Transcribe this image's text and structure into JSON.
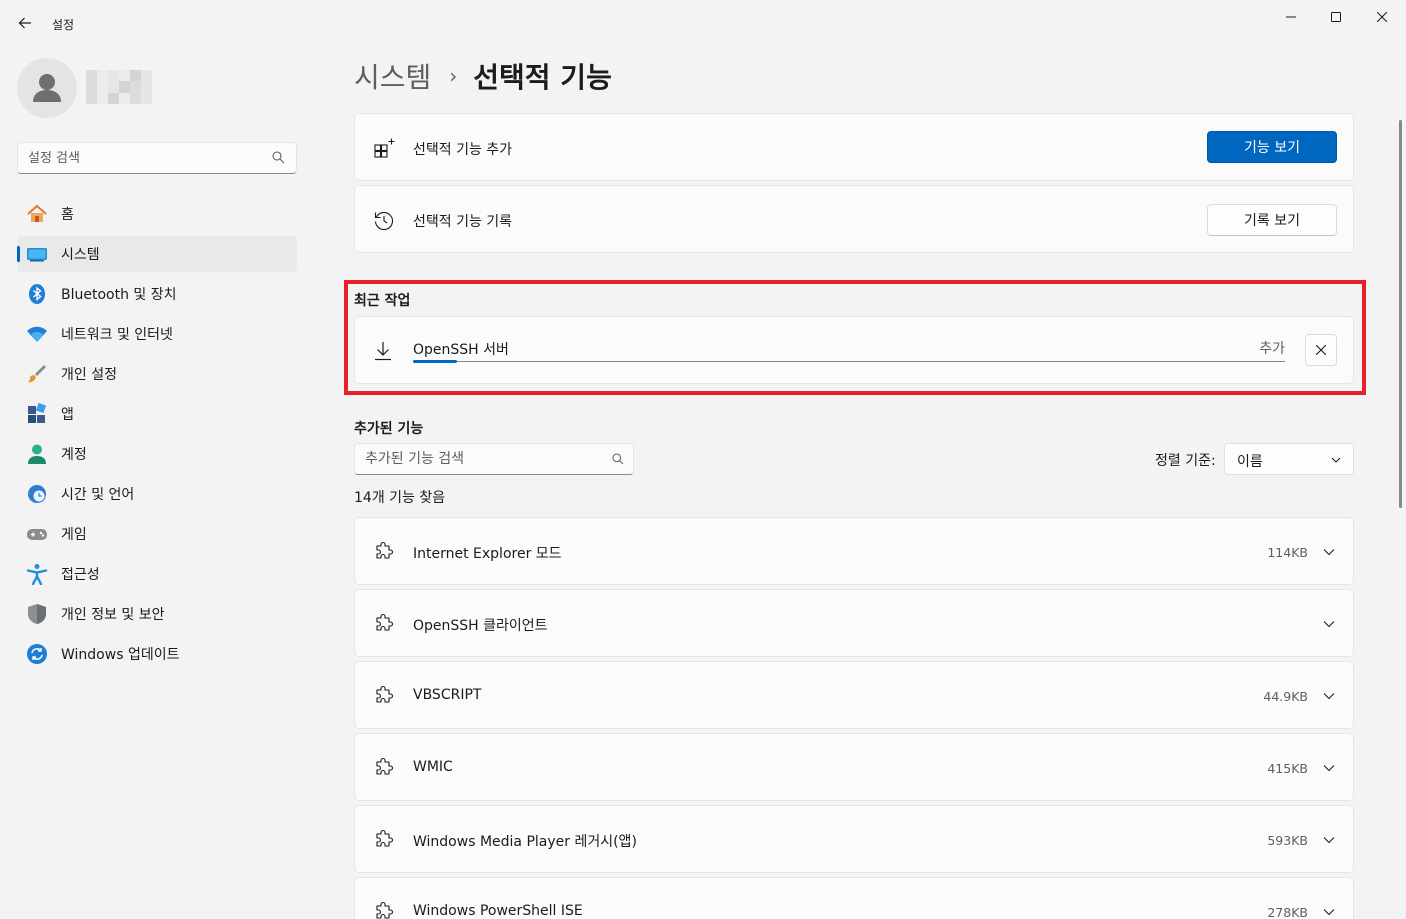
{
  "window": {
    "title": "설정",
    "back_icon": "arrow-left-icon",
    "controls": [
      "minimize",
      "maximize",
      "close"
    ]
  },
  "sidebar": {
    "search_placeholder": "설정 검색",
    "items": [
      {
        "label": "홈",
        "icon": "home-icon",
        "active": false
      },
      {
        "label": "시스템",
        "icon": "system-monitor-icon",
        "active": true
      },
      {
        "label": "Bluetooth 및 장치",
        "icon": "bluetooth-icon",
        "active": false
      },
      {
        "label": "네트워크 및 인터넷",
        "icon": "wifi-icon",
        "active": false
      },
      {
        "label": "개인 설정",
        "icon": "paintbrush-icon",
        "active": false
      },
      {
        "label": "앱",
        "icon": "apps-icon",
        "active": false
      },
      {
        "label": "계정",
        "icon": "account-icon",
        "active": false
      },
      {
        "label": "시간 및 언어",
        "icon": "globe-clock-icon",
        "active": false
      },
      {
        "label": "게임",
        "icon": "gamepad-icon",
        "active": false
      },
      {
        "label": "접근성",
        "icon": "accessibility-icon",
        "active": false
      },
      {
        "label": "개인 정보 및 보안",
        "icon": "shield-icon",
        "active": false
      },
      {
        "label": "Windows 업데이트",
        "icon": "update-icon",
        "active": false
      }
    ]
  },
  "breadcrumb": {
    "parent": "시스템",
    "separator": "›",
    "current": "선택적 기능"
  },
  "actions": {
    "add": {
      "label": "선택적 기능 추가",
      "button": "기능 보기",
      "icon": "add-grid-icon"
    },
    "history": {
      "label": "선택적 기능 기록",
      "button": "기록 보기",
      "icon": "history-icon"
    }
  },
  "recent": {
    "title": "최근 작업",
    "item": {
      "name": "OpenSSH 서버",
      "status": "추가",
      "progress_fraction": 0.05,
      "icon": "download-icon"
    }
  },
  "installed": {
    "title": "추가된 기능",
    "search_placeholder": "추가된 기능 검색",
    "sort_label": "정렬 기준:",
    "sort_value": "이름",
    "count_text": "14개 기능 찾음",
    "features": [
      {
        "name": "Internet Explorer 모드",
        "size": "114KB"
      },
      {
        "name": "OpenSSH 클라이언트",
        "size": ""
      },
      {
        "name": "VBSCRIPT",
        "size": "44.9KB"
      },
      {
        "name": "WMIC",
        "size": "415KB"
      },
      {
        "name": "Windows Media Player 레거시(앱)",
        "size": "593KB"
      },
      {
        "name": "Windows PowerShell ISE",
        "size": "278KB"
      }
    ]
  },
  "colors": {
    "accent": "#0067c0",
    "highlight": "#e8202a",
    "background": "#f3f3f3",
    "card": "#fbfbfb"
  }
}
